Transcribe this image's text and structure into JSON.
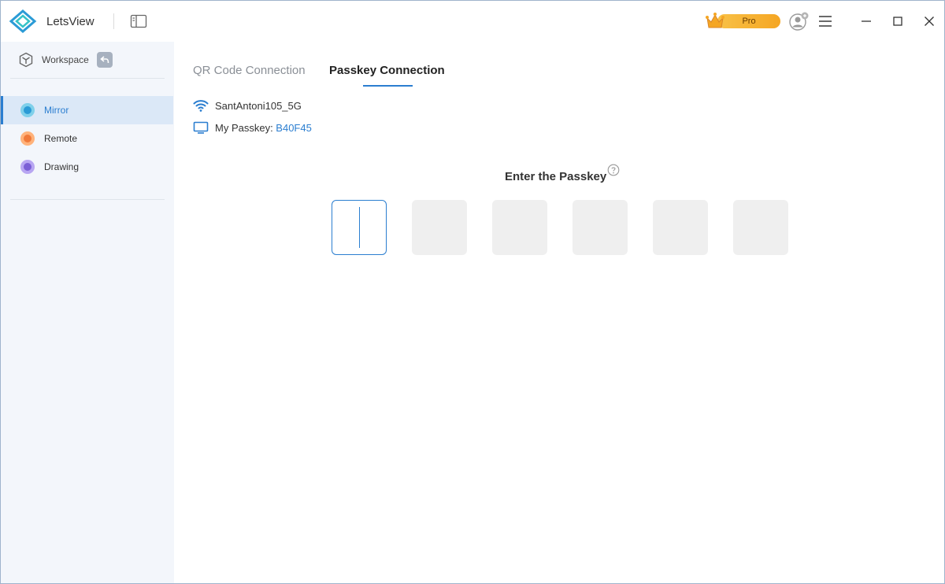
{
  "app": {
    "name": "LetsView"
  },
  "titlebar": {
    "pro_label": "Pro",
    "icons": [
      "letsview-logo-icon",
      "sidebar-toggle-icon",
      "crown-icon",
      "user-avatar-icon",
      "hamburger-menu-icon",
      "minimize-icon",
      "maximize-icon",
      "close-icon"
    ]
  },
  "sidebar": {
    "workspace_label": "Workspace",
    "items": [
      {
        "label": "Mirror",
        "active": true,
        "color": "#2b9bd6"
      },
      {
        "label": "Remote",
        "active": false,
        "color": "#f07a3a"
      },
      {
        "label": "Drawing",
        "active": false,
        "color": "#7b5fd6"
      }
    ]
  },
  "main": {
    "tabs": [
      {
        "label": "QR Code Connection",
        "active": false
      },
      {
        "label": "Passkey Connection",
        "active": true
      }
    ],
    "wifi_name": "SantAntoni105_5G",
    "passkey_label": "My Passkey: ",
    "passkey_value": "B40F45",
    "enter_title": "Enter the Passkey",
    "passkey_inputs": [
      "",
      "",
      "",
      "",
      "",
      ""
    ]
  },
  "colors": {
    "accent": "#2b7ed0",
    "pro": "#f5a623",
    "sidebar_bg": "#f3f6fb"
  }
}
